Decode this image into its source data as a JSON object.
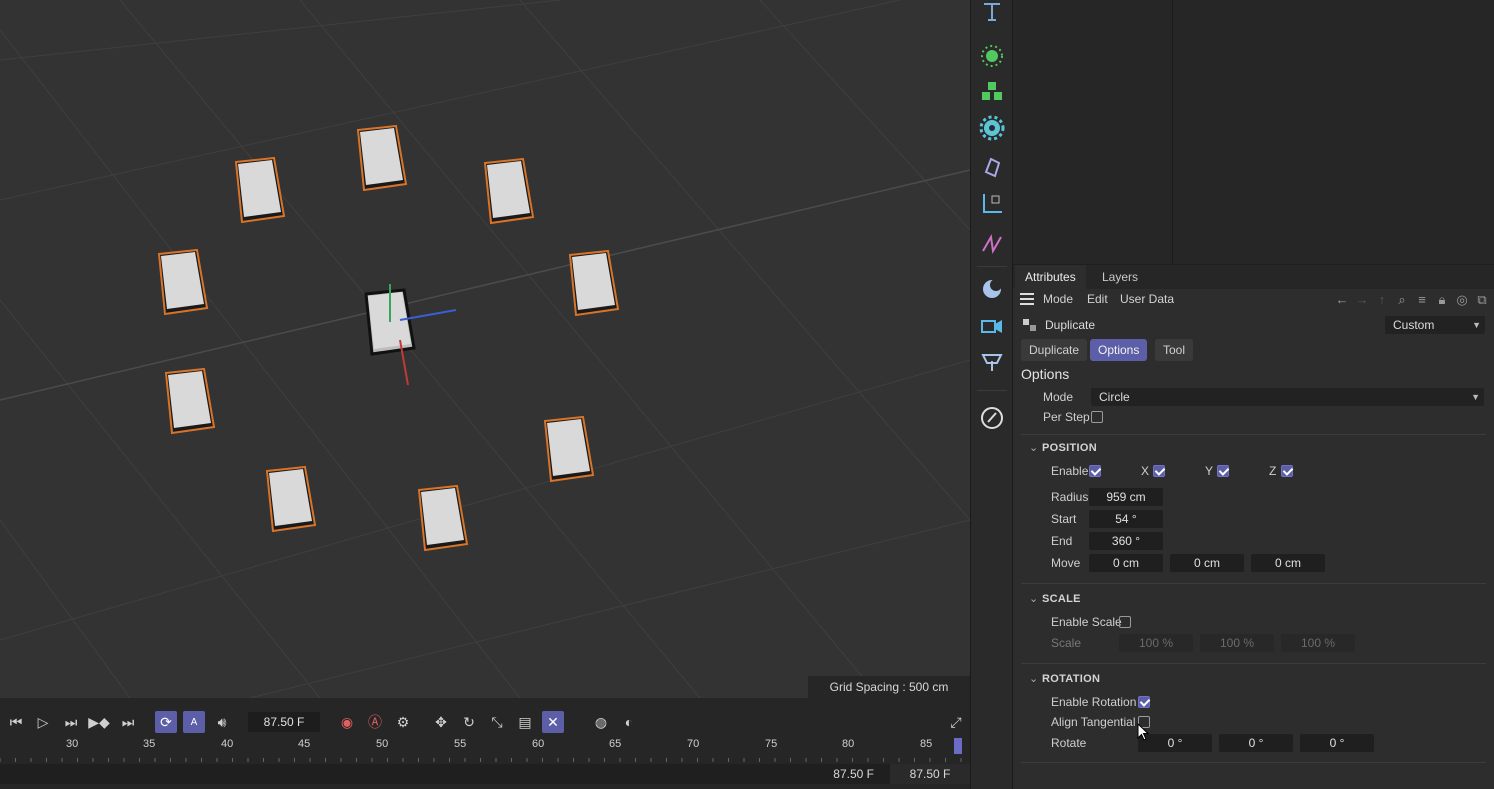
{
  "viewport": {
    "grid_spacing": "Grid Spacing : 500 cm"
  },
  "attributes": {
    "tabs": [
      "Attributes",
      "Layers"
    ],
    "menu": [
      "Mode",
      "Edit",
      "User Data"
    ],
    "object_name": "Duplicate",
    "preset": "Custom",
    "page_tabs": [
      "Duplicate",
      "Options",
      "Tool"
    ],
    "section": "Options",
    "mode_label": "Mode",
    "mode_value": "Circle",
    "per_step_label": "Per Step",
    "position": {
      "title": "POSITION",
      "enable_label": "Enable",
      "x_label": "X",
      "y_label": "Y",
      "z_label": "Z",
      "radius_label": "Radius",
      "radius": "959 cm",
      "start_label": "Start",
      "start": "54 °",
      "end_label": "End",
      "end": "360 °",
      "move_label": "Move",
      "move": [
        "0 cm",
        "0 cm",
        "0 cm"
      ]
    },
    "scale": {
      "title": "SCALE",
      "enable_label": "Enable Scale",
      "scale_label": "Scale",
      "values": [
        "100 %",
        "100 %",
        "100 %"
      ]
    },
    "rotation": {
      "title": "ROTATION",
      "enable_label": "Enable Rotation",
      "align_label": "Align Tangential",
      "rotate_label": "Rotate",
      "values": [
        "0 °",
        "0 °",
        "0 °"
      ]
    }
  },
  "timeline": {
    "current_frame": "87.50 F",
    "ruler": [
      "30",
      "35",
      "40",
      "45",
      "50",
      "55",
      "60",
      "65",
      "70",
      "75",
      "80",
      "85"
    ],
    "status_left": "87.50 F",
    "status_right": "87.50 F"
  }
}
